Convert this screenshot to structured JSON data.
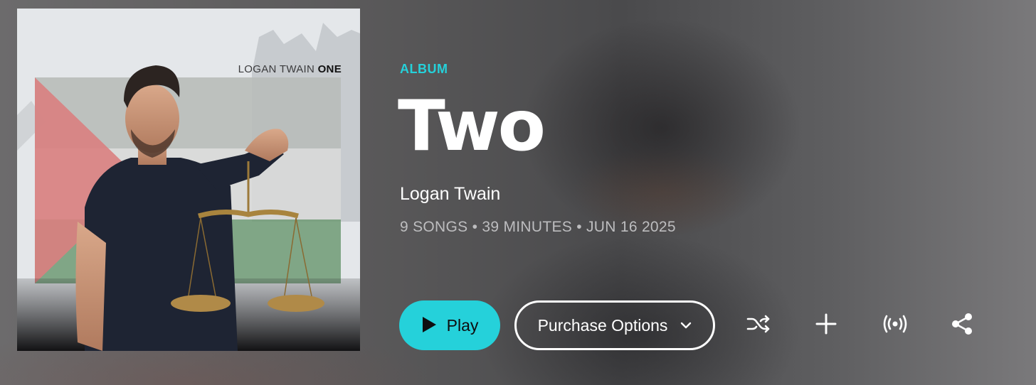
{
  "album": {
    "cover": {
      "caption_artist": "LOGAN TWAIN",
      "caption_title": "ONE"
    },
    "kind": "ALBUM",
    "title": "Two",
    "artist": "Logan Twain",
    "meta": "9 SONGS • 39 MINUTES • JUN 16 2025"
  },
  "actions": {
    "play_label": "Play",
    "purchase_label": "Purchase Options",
    "icons": [
      "play-icon",
      "chevron-down-icon",
      "shuffle-icon",
      "add-icon",
      "radio-broadcast-icon",
      "share-icon"
    ]
  },
  "colors": {
    "accent": "#25d1da",
    "text": "#ffffff",
    "meta": "#bdbdbf"
  }
}
